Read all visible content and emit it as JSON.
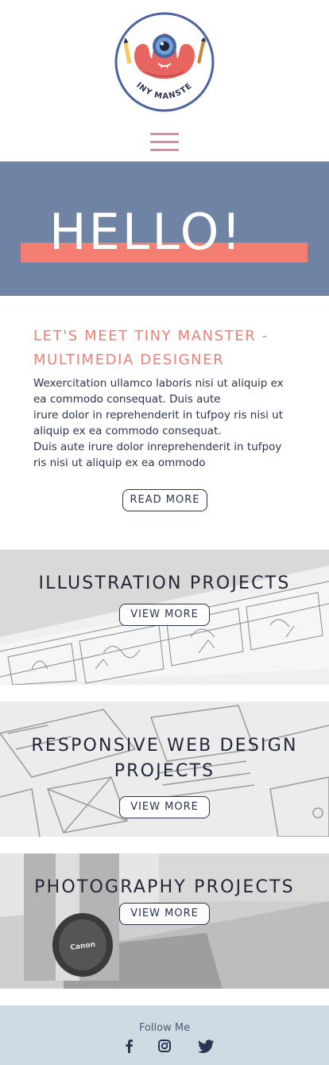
{
  "brand": {
    "logo_text": "TINY MANSTER"
  },
  "nav": {
    "menu_icon": "hamburger-menu-icon"
  },
  "hero": {
    "title": "HELLO!"
  },
  "intro": {
    "heading_line1": "LET'S MEET TINY MANSTER -",
    "heading_line2": "MULTIMEDIA DESIGNER",
    "paragraphs": [
      "Wexercitation ullamco laboris nisi ut aliquip ex ea commodo consequat. Duis  aute",
      "irure dolor in reprehenderit in tufpoy ris nisi ut aliquip ex ea commodo consequat.",
      "Duis aute irure dolor inreprehenderit in tufpoy ris nisi ut aliquip ex ea ommodo"
    ],
    "read_more_label": "READ MORE"
  },
  "projects": [
    {
      "title": "ILLUSTRATION PROJECTS",
      "button_label": "VIEW MORE"
    },
    {
      "title_line1": "RESPONSIVE WEB DESIGN",
      "title_line2": "PROJECTS",
      "button_label": "VIEW MORE"
    },
    {
      "title": "PHOTOGRAPHY PROJECTS",
      "button_label": "VIEW MORE",
      "lens_cap_text": "Canon"
    }
  ],
  "footer": {
    "follow_label": "Follow Me",
    "social": [
      "facebook-icon",
      "instagram-icon",
      "twitter-icon"
    ]
  },
  "colors": {
    "hero_bg": "#6f83a5",
    "accent_coral": "#f47e72",
    "heading_coral": "#ef7f74",
    "text_navy": "#2b3550",
    "menu_pink": "#d48f98",
    "footer_bg": "#d0dae2"
  }
}
